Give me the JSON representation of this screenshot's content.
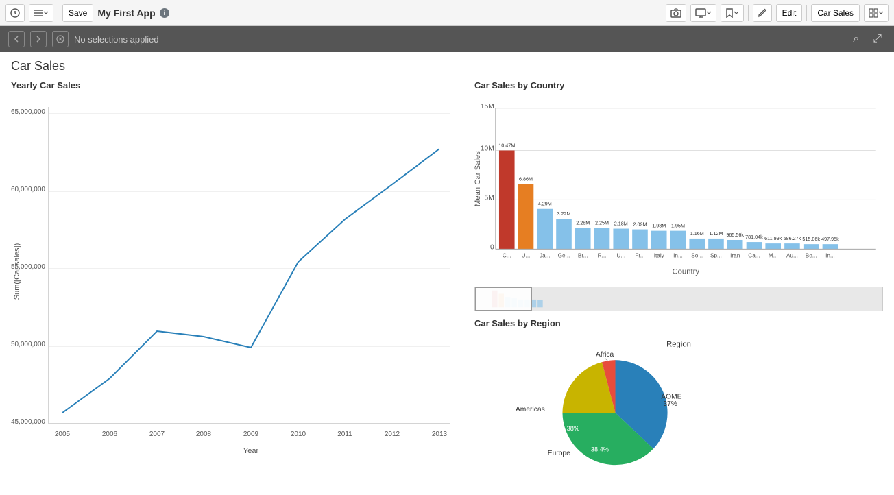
{
  "toolbar": {
    "save_label": "Save",
    "app_title": "My First App",
    "edit_label": "Edit",
    "sheet_label": "Car Sales"
  },
  "selection_bar": {
    "no_selections_text": "No selections applied"
  },
  "page": {
    "title": "Car Sales"
  },
  "yearly_chart": {
    "title": "Yearly Car Sales",
    "x_axis_label": "Year",
    "y_axis_label": "Sum([Car sales])",
    "y_ticks": [
      "65,000,000",
      "60,000,000",
      "55,000,000",
      "50,000,000",
      "45,000,000"
    ],
    "x_ticks": [
      "2005",
      "2006",
      "2007",
      "2008",
      "2009",
      "2010",
      "2011",
      "2012",
      "2013"
    ],
    "data_points": [
      {
        "year": "2005",
        "value": 44800000
      },
      {
        "year": "2006",
        "value": 47200000
      },
      {
        "year": "2007",
        "value": 50600000
      },
      {
        "year": "2008",
        "value": 50200000
      },
      {
        "year": "2009",
        "value": 49400000
      },
      {
        "year": "2010",
        "value": 55500000
      },
      {
        "year": "2011",
        "value": 58500000
      },
      {
        "year": "2012",
        "value": 61000000
      },
      {
        "year": "2013",
        "value": 63500000
      }
    ]
  },
  "bar_chart": {
    "title": "Car Sales by Country",
    "x_axis_label": "Country",
    "y_axis_label": "Mean Car Sales",
    "y_ticks": [
      "0",
      "5M",
      "10M",
      "15M"
    ],
    "bars": [
      {
        "country": "C...",
        "value": 10470000,
        "label": "10.47M",
        "color": "#c0392b"
      },
      {
        "country": "U...",
        "value": 6860000,
        "label": "6.86M",
        "color": "#e67e22"
      },
      {
        "country": "Ja...",
        "value": 4290000,
        "label": "4.29M",
        "color": "#85c1e9"
      },
      {
        "country": "Ge...",
        "value": 3220000,
        "label": "3.22M",
        "color": "#85c1e9"
      },
      {
        "country": "Br...",
        "value": 2280000,
        "label": "2.28M",
        "color": "#85c1e9"
      },
      {
        "country": "R...",
        "value": 2250000,
        "label": "2.25M",
        "color": "#85c1e9"
      },
      {
        "country": "U...",
        "value": 2180000,
        "label": "2.18M",
        "color": "#85c1e9"
      },
      {
        "country": "Fr...",
        "value": 2090000,
        "label": "2.09M",
        "color": "#85c1e9"
      },
      {
        "country": "Italy",
        "value": 1980000,
        "label": "1.98M",
        "color": "#85c1e9"
      },
      {
        "country": "In...",
        "value": 1950000,
        "label": "1.95M",
        "color": "#85c1e9"
      },
      {
        "country": "So...",
        "value": 1160000,
        "label": "1.16M",
        "color": "#85c1e9"
      },
      {
        "country": "Sp...",
        "value": 1120000,
        "label": "1.12M",
        "color": "#85c1e9"
      },
      {
        "country": "Iran",
        "value": 965600,
        "label": "965.56k",
        "color": "#85c1e9"
      },
      {
        "country": "Ca...",
        "value": 781000,
        "label": "781.04k",
        "color": "#85c1e9"
      },
      {
        "country": "M...",
        "value": 612000,
        "label": "611.99k",
        "color": "#85c1e9"
      },
      {
        "country": "Au...",
        "value": 586000,
        "label": "586.27k",
        "color": "#85c1e9"
      },
      {
        "country": "Be...",
        "value": 516000,
        "label": "515.06k",
        "color": "#85c1e9"
      },
      {
        "country": "In...",
        "value": 498000,
        "label": "497.95k",
        "color": "#85c1e9"
      }
    ]
  },
  "pie_chart": {
    "title": "Car Sales by Region",
    "legend_title": "Region",
    "segments": [
      {
        "region": "AOME",
        "percentage": "37%",
        "color": "#2980b9"
      },
      {
        "region": "Europe",
        "percentage": "38.4%",
        "color": "#27ae60"
      },
      {
        "region": "Americas",
        "percentage": "38%",
        "color": "#c8b400"
      },
      {
        "region": "Africa",
        "percentage": "4%",
        "color": "#e74c3c"
      }
    ]
  }
}
